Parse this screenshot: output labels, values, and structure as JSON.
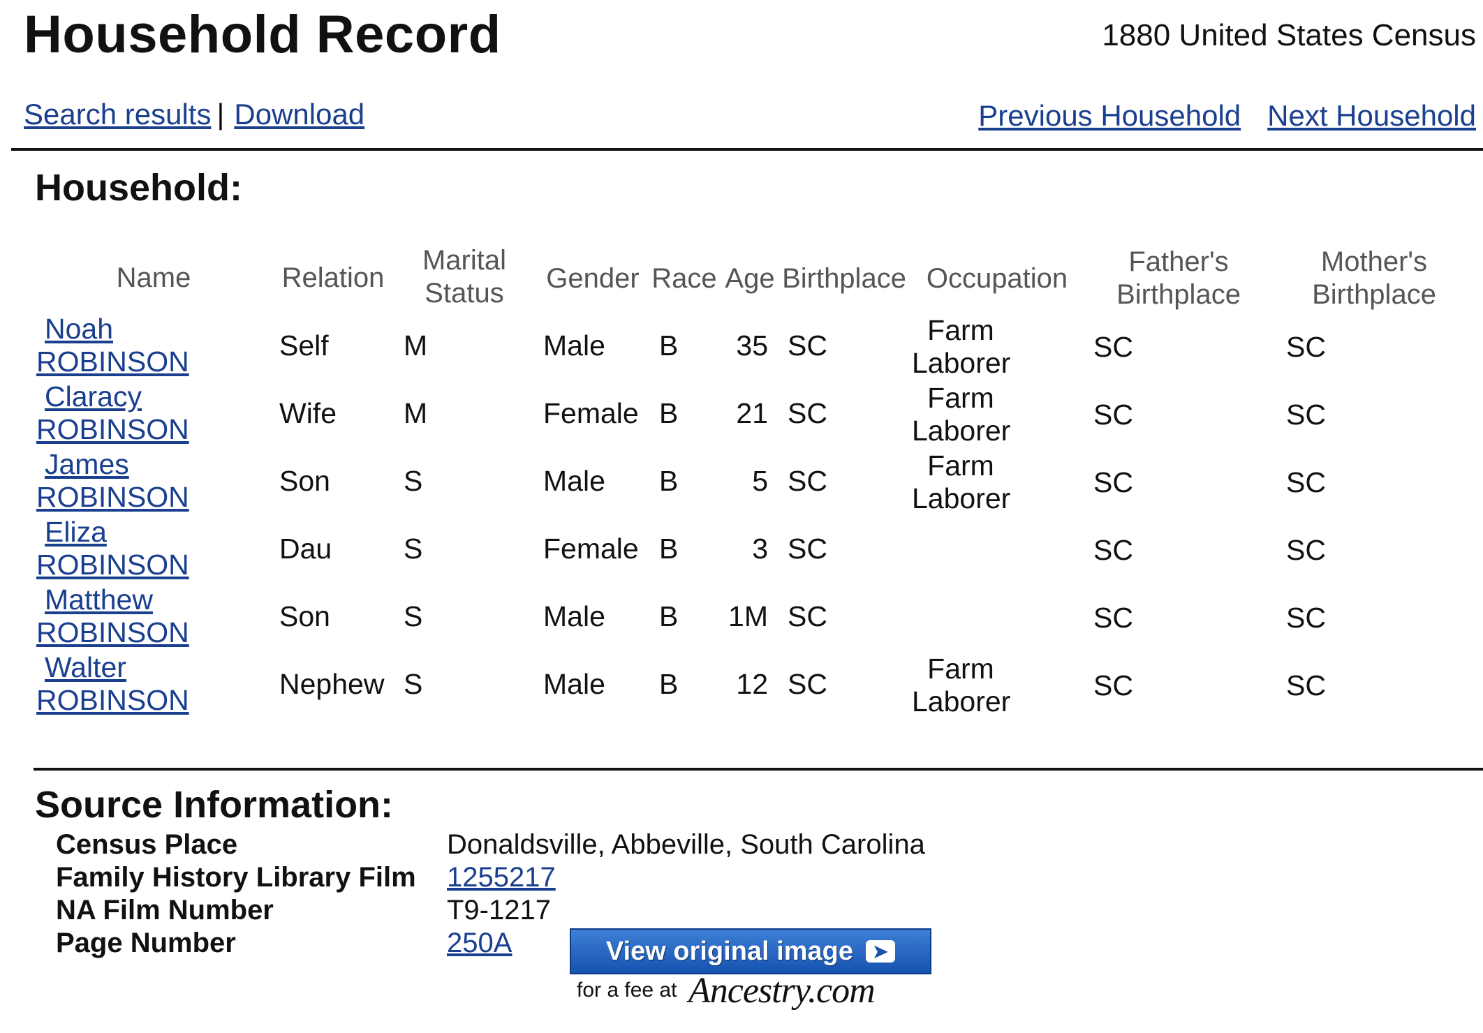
{
  "header": {
    "title": "Household Record",
    "census": "1880 United States Census"
  },
  "nav": {
    "search_results": "Search results",
    "separator": "|",
    "download": "Download",
    "previous": "Previous Household",
    "next": "Next Household"
  },
  "household": {
    "heading": "Household:",
    "columns": {
      "name": "Name",
      "relation": "Relation",
      "marital": [
        "Marital",
        "Status"
      ],
      "gender": "Gender",
      "race": "Race",
      "age": "Age",
      "birthplace": "Birthplace",
      "occupation": "Occupation",
      "father": [
        "Father's",
        "Birthplace"
      ],
      "mother": [
        "Mother's",
        "Birthplace"
      ]
    },
    "rows": [
      {
        "first": "Noah",
        "last": "ROBINSON",
        "relation": "Self",
        "marital": "M",
        "gender": "Male",
        "race": "B",
        "age": "35",
        "birthplace": "SC",
        "occ1": "Farm",
        "occ2": "Laborer",
        "father": "SC",
        "mother": "SC"
      },
      {
        "first": "Claracy",
        "last": "ROBINSON",
        "relation": "Wife",
        "marital": "M",
        "gender": "Female",
        "race": "B",
        "age": "21",
        "birthplace": "SC",
        "occ1": "Farm",
        "occ2": "Laborer",
        "father": "SC",
        "mother": "SC"
      },
      {
        "first": "James",
        "last": "ROBINSON",
        "relation": "Son",
        "marital": "S",
        "gender": "Male",
        "race": "B",
        "age": "5",
        "birthplace": "SC",
        "occ1": "Farm",
        "occ2": "Laborer",
        "father": "SC",
        "mother": "SC"
      },
      {
        "first": "Eliza",
        "last": "ROBINSON",
        "relation": "Dau",
        "marital": "S",
        "gender": "Female",
        "race": "B",
        "age": "3",
        "birthplace": "SC",
        "occ1": "",
        "occ2": "",
        "father": "SC",
        "mother": "SC"
      },
      {
        "first": "Matthew",
        "last": "ROBINSON",
        "relation": "Son",
        "marital": "S",
        "gender": "Male",
        "race": "B",
        "age": "1M",
        "birthplace": "SC",
        "occ1": "",
        "occ2": "",
        "father": "SC",
        "mother": "SC"
      },
      {
        "first": "Walter",
        "last": "ROBINSON",
        "relation": "Nephew",
        "marital": "S",
        "gender": "Male",
        "race": "B",
        "age": "12",
        "birthplace": "SC",
        "occ1": "Farm",
        "occ2": "Laborer",
        "father": "SC",
        "mother": "SC"
      }
    ]
  },
  "source": {
    "heading": "Source Information:",
    "census_place_label": "Census Place",
    "census_place": "Donaldsville, Abbeville, South Carolina",
    "fhl_film_label": "Family History Library Film",
    "fhl_film": "1255217",
    "na_film_label": "NA Film Number",
    "na_film": "T9-1217",
    "page_label": "Page Number",
    "page": "250A"
  },
  "view_button": {
    "label": "View original image",
    "fee_text": "for a fee at",
    "brand": "Ancestry.com"
  }
}
